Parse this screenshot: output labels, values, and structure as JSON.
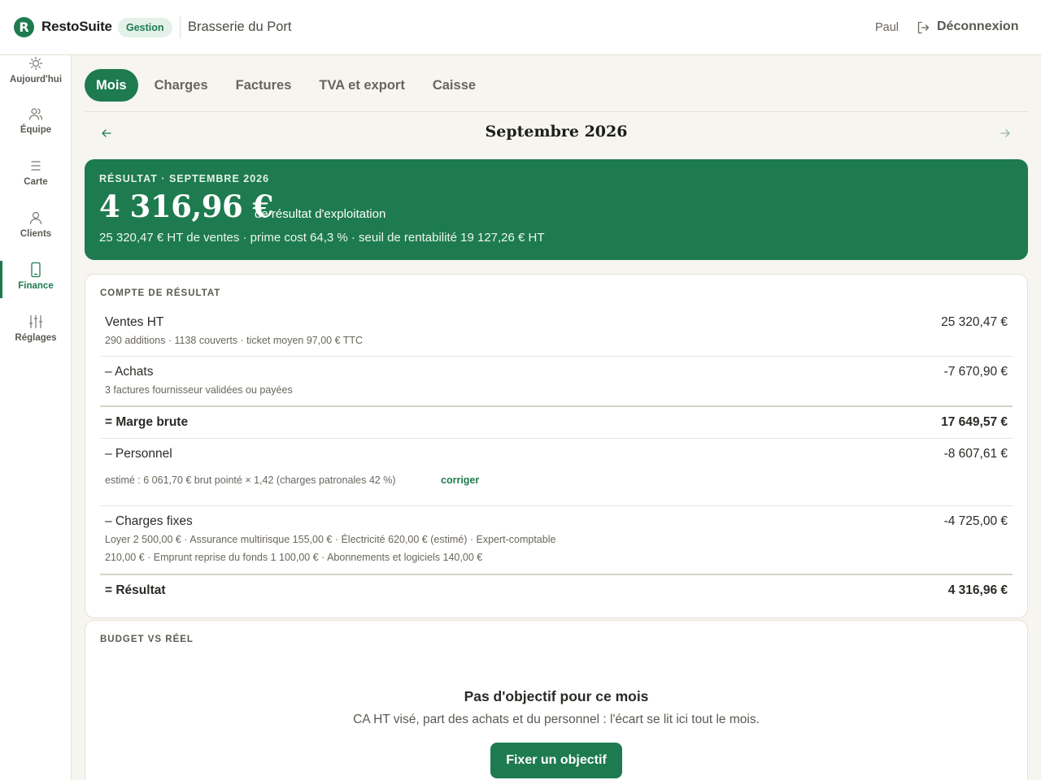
{
  "app": {
    "logo_letter": "R",
    "name": "RestoSuite",
    "module_badge": "Gestion",
    "restaurant": "Brasserie du Port"
  },
  "user": {
    "name": "Paul",
    "logout_label": "Déconnexion"
  },
  "sidebar": {
    "items": [
      {
        "label": "Aujourd'hui",
        "icon": "sun-icon"
      },
      {
        "label": "Équipe",
        "icon": "team-icon"
      },
      {
        "label": "Carte",
        "icon": "menu-list-icon"
      },
      {
        "label": "Clients",
        "icon": "person-icon"
      },
      {
        "label": "Finance",
        "icon": "phone-icon",
        "active": true
      },
      {
        "label": "Réglages",
        "icon": "sliders-icon"
      }
    ]
  },
  "tabs": [
    {
      "label": "Mois",
      "active": true
    },
    {
      "label": "Charges"
    },
    {
      "label": "Factures"
    },
    {
      "label": "TVA et export"
    },
    {
      "label": "Caisse"
    }
  ],
  "period": {
    "title": "Septembre 2026"
  },
  "summary": {
    "eyebrow": "RÉSULTAT · SEPTEMBRE 2026",
    "amount": "4 316,96 €",
    "caption": "de résultat d'exploitation",
    "details": "25 320,47 € HT de ventes · prime cost 64,3 % · seuil de rentabilité 19 127,26 € HT"
  },
  "income_statement": {
    "title": "COMPTE DE RÉSULTAT",
    "sales": {
      "label": "Ventes HT",
      "value": "25 320,47 €",
      "note": "290 additions · 1138 couverts · ticket moyen 97,00 € TTC"
    },
    "purchases": {
      "label": "– Achats",
      "value": "-7 670,90 €",
      "note": "3 factures fournisseur validées ou payées"
    },
    "gross_margin": {
      "label": "= Marge brute",
      "value": "17 649,57 €"
    },
    "staff": {
      "label": "– Personnel",
      "value": "-8 607,61 €",
      "note": "estimé : 6 061,70 € brut pointé × 1,42 (charges patronales 42 %)",
      "link": "corriger"
    },
    "fixed_costs": {
      "label": "– Charges fixes",
      "value": "-4 725,00 €",
      "note_line1": "Loyer 2 500,00 € · Assurance multirisque 155,00 € · Électricité 620,00 € (estimé) · Expert-comptable",
      "note_line2": "210,00 € · Emprunt reprise du fonds 1 100,00 € · Abonnements et logiciels 140,00 €"
    },
    "result": {
      "label": "= Résultat",
      "value": "4 316,96 €"
    }
  },
  "budget": {
    "title": "BUDGET VS RÉEL",
    "empty_title": "Pas d'objectif pour ce mois",
    "empty_text": "CA HT visé, part des achats et du personnel : l'écart se lit ici tout le mois.",
    "button": "Fixer un objectif"
  },
  "colors": {
    "brand": "#1e7b4f",
    "background": "#f7f5f0",
    "surface": "#ffffff"
  }
}
